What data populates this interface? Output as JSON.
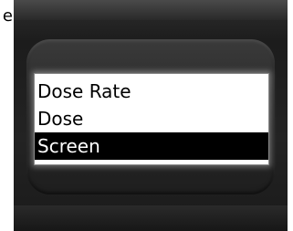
{
  "edge_text": "e",
  "menu": {
    "items": [
      {
        "label": "Dose Rate",
        "selected": false
      },
      {
        "label": "Dose",
        "selected": false
      },
      {
        "label": "Screen",
        "selected": true
      }
    ]
  },
  "colors": {
    "device_body": "#1e1e1e",
    "screen_background": "#ffffff",
    "selected_background": "#000000",
    "selected_text": "#ffffff",
    "item_text": "#000000"
  }
}
